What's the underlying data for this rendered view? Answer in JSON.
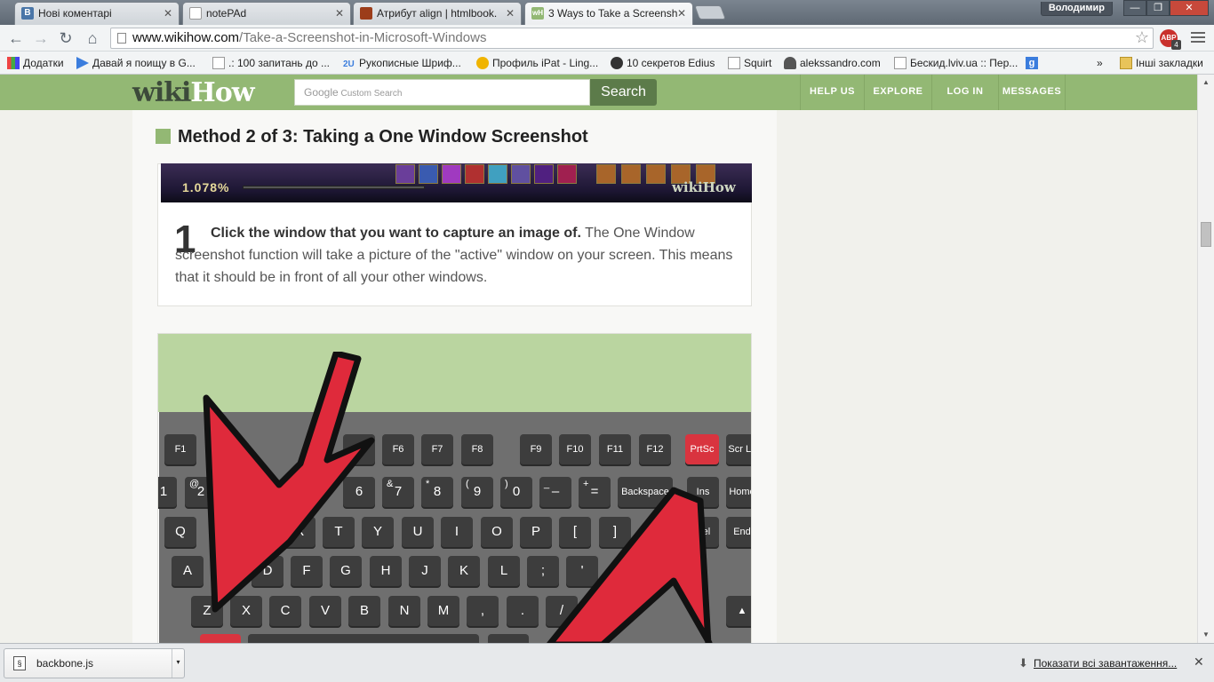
{
  "browser": {
    "tabs": [
      {
        "title": "Нові коментарі",
        "favicon": "B",
        "favicon_color": "#4a76a8"
      },
      {
        "title": "notePAd",
        "favicon": "",
        "favicon_color": "#ffffff"
      },
      {
        "title": "Атрибут align | htmlbook.",
        "favicon": "",
        "favicon_color": "#9c3d1a"
      },
      {
        "title": "3 Ways to Take a Screensh",
        "favicon": "wH",
        "favicon_color": "#93b874"
      }
    ],
    "user": "Володимир",
    "url_domain": "www.wikihow.com",
    "url_path": "/Take-a-Screenshot-in-Microsoft-Windows",
    "abp_label": "ABP",
    "abp_count": "4"
  },
  "bookmarks": {
    "items": [
      "Додатки",
      "Давай я поищу в G...",
      ".: 100 запитань до ...",
      "Рукописные Шриф...",
      "Профиль iPat - Ling...",
      "10 секретов Edius",
      "Squirt",
      "alekssandro.com",
      "Бескид.lviv.ua :: Пер...",
      "Інші закладки"
    ],
    "overflow": "»"
  },
  "wikihow": {
    "logo_wiki": "wiki",
    "logo_how": "How",
    "search_placeholder": "Custom Search",
    "search_brand": "Google",
    "search_button": "Search",
    "nav": [
      "HELP US",
      "EXPLORE",
      "LOG IN",
      "MESSAGES"
    ]
  },
  "article": {
    "method_heading": "Method 2 of 3: Taking a One Window Screenshot",
    "game_percent": "1.078%",
    "game_watermark": "wikiHow",
    "step_number": "1",
    "step_bold": "Click the window that you want to capture an image of.",
    "step_rest": " The One Window screenshot function will take a picture of the \"active\" window on your screen. This means that it should be in front of all your other windows."
  },
  "keyboard": {
    "fn_row": [
      "F1",
      "F5",
      "F6",
      "F7",
      "F8",
      "F9",
      "F10",
      "F11",
      "F12",
      "PrtSc",
      "Scr Lk"
    ],
    "num_row": [
      "1",
      "2",
      "6",
      "7",
      "8",
      "9",
      "0",
      "–",
      "=",
      "Backspace",
      "Ins",
      "Home"
    ],
    "num_row_shift": [
      "",
      "@",
      "",
      "&",
      "*",
      "(",
      ")",
      "_",
      "+"
    ],
    "q_row": [
      "Q",
      "R",
      "T",
      "Y",
      "U",
      "I",
      "O",
      "P",
      "[",
      "]",
      "Del",
      "End"
    ],
    "a_row": [
      "A",
      "D",
      "F",
      "G",
      "H",
      "J",
      "K",
      "L",
      ";",
      "'"
    ],
    "z_row": [
      "Z",
      "X",
      "C",
      "V",
      "B",
      "N",
      "M",
      ",",
      ".",
      "/",
      "▲"
    ],
    "highlight_color": "#d9343f"
  },
  "downloads": {
    "file": "backbone.js",
    "show_all": "Показати всі завантаження..."
  }
}
